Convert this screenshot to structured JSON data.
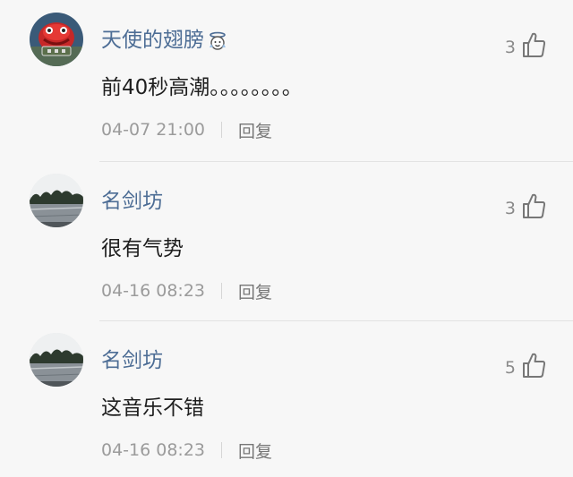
{
  "comments": [
    {
      "username": "天使的翅膀",
      "has_badge": true,
      "badge_icon": "angel-badge-icon",
      "avatar": "red-creature-avatar",
      "likes": "3",
      "content": "前40秒高潮。。。。。。。。",
      "timestamp": "04-07 21:00",
      "reply_label": "回复"
    },
    {
      "username": "名剑坊",
      "has_badge": false,
      "avatar": "lake-landscape-avatar",
      "likes": "3",
      "content": "很有气势",
      "timestamp": "04-16 08:23",
      "reply_label": "回复"
    },
    {
      "username": "名剑坊",
      "has_badge": false,
      "avatar": "lake-landscape-avatar",
      "likes": "5",
      "content": "这音乐不错",
      "timestamp": "04-16 08:23",
      "reply_label": "回复"
    }
  ],
  "icons": {
    "like": "thumbs-up-icon"
  },
  "colors": {
    "username": "#4d6d95",
    "content": "#1f1f1f",
    "meta": "#9b9b9b",
    "background": "#f7f7f7"
  }
}
